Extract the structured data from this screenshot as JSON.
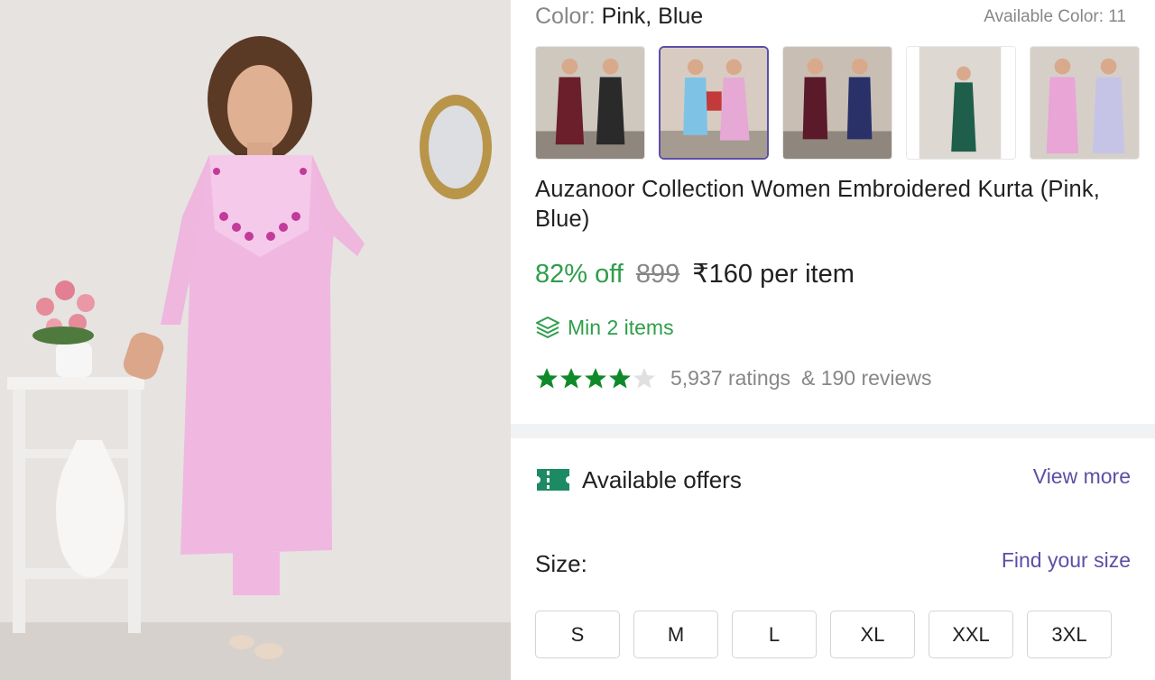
{
  "product": {
    "color_label": "Color:",
    "color_value": "Pink, Blue",
    "available_colors": "Available Color: 11",
    "title": "Auzanoor Collection Women Embroidered Kurta (Pink, Blue)",
    "discount": "82% off",
    "mrp": "899",
    "price": "₹160 per item",
    "min_items": "Min 2 items",
    "rating_value": 4,
    "rating_max": 5,
    "ratings_count": "5,937 ratings",
    "reviews_count": "& 190 reviews"
  },
  "thumbnails": [
    {
      "name": "maroon-black",
      "colors": [
        "#6b1f2a",
        "#2a2a2a"
      ],
      "active": false
    },
    {
      "name": "blue-pink",
      "colors": [
        "#7ec3e6",
        "#e6a9d6"
      ],
      "active": true
    },
    {
      "name": "wine-navy",
      "colors": [
        "#5a1a2a",
        "#2a3169"
      ],
      "active": false
    },
    {
      "name": "green",
      "colors": [
        "#1f5e4a"
      ],
      "active": false
    },
    {
      "name": "pink-lavender",
      "colors": [
        "#e8a5d6",
        "#c5c4e6"
      ],
      "active": false
    }
  ],
  "offers": {
    "label": "Available offers",
    "view_more": "View more",
    "icon": "ticket-icon"
  },
  "size": {
    "label": "Size:",
    "find_size": "Find your size",
    "options": [
      "S",
      "M",
      "L",
      "XL",
      "XXL",
      "3XL"
    ]
  },
  "colors": {
    "accent": "#5b4fa6",
    "discount_green": "#2e9e4a",
    "star_green": "#0f8a2a",
    "muted": "#878787"
  }
}
